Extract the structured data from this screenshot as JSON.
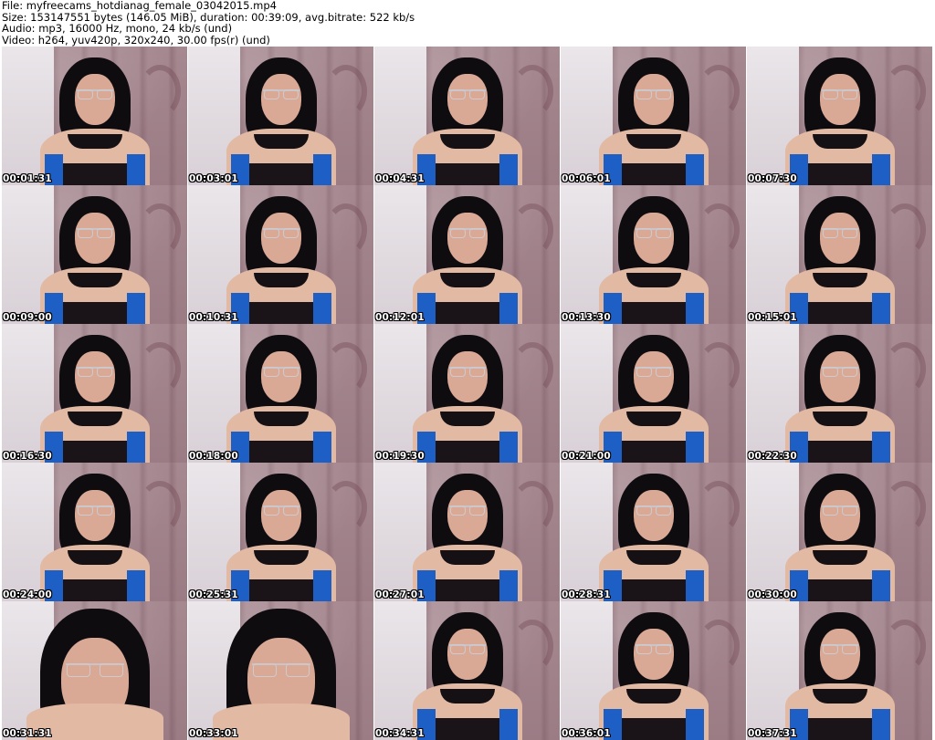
{
  "header": {
    "file_line": "File: myfreecams_hotdianag_female_03042015.mp4",
    "size_line": "Size: 153147551 bytes (146.05 MiB), duration: 00:39:09, avg.bitrate: 522 kb/s",
    "audio_line": "Audio: mp3, 16000 Hz, mono, 24 kb/s (und)",
    "video_line": "Video: h264, yuv420p, 320x240, 30.00 fps(r) (und)"
  },
  "thumbnails": [
    {
      "timestamp": "00:01:31"
    },
    {
      "timestamp": "00:03:01"
    },
    {
      "timestamp": "00:04:31"
    },
    {
      "timestamp": "00:06:01"
    },
    {
      "timestamp": "00:07:30"
    },
    {
      "timestamp": "00:09:00"
    },
    {
      "timestamp": "00:10:31"
    },
    {
      "timestamp": "00:12:01"
    },
    {
      "timestamp": "00:13:30"
    },
    {
      "timestamp": "00:15:01"
    },
    {
      "timestamp": "00:16:30"
    },
    {
      "timestamp": "00:18:00"
    },
    {
      "timestamp": "00:19:30"
    },
    {
      "timestamp": "00:21:00"
    },
    {
      "timestamp": "00:22:30"
    },
    {
      "timestamp": "00:24:00"
    },
    {
      "timestamp": "00:25:31"
    },
    {
      "timestamp": "00:27:01"
    },
    {
      "timestamp": "00:28:31"
    },
    {
      "timestamp": "00:30:00"
    },
    {
      "timestamp": "00:31:31"
    },
    {
      "timestamp": "00:33:01"
    },
    {
      "timestamp": "00:34:31"
    },
    {
      "timestamp": "00:36:01"
    },
    {
      "timestamp": "00:37:31"
    }
  ]
}
